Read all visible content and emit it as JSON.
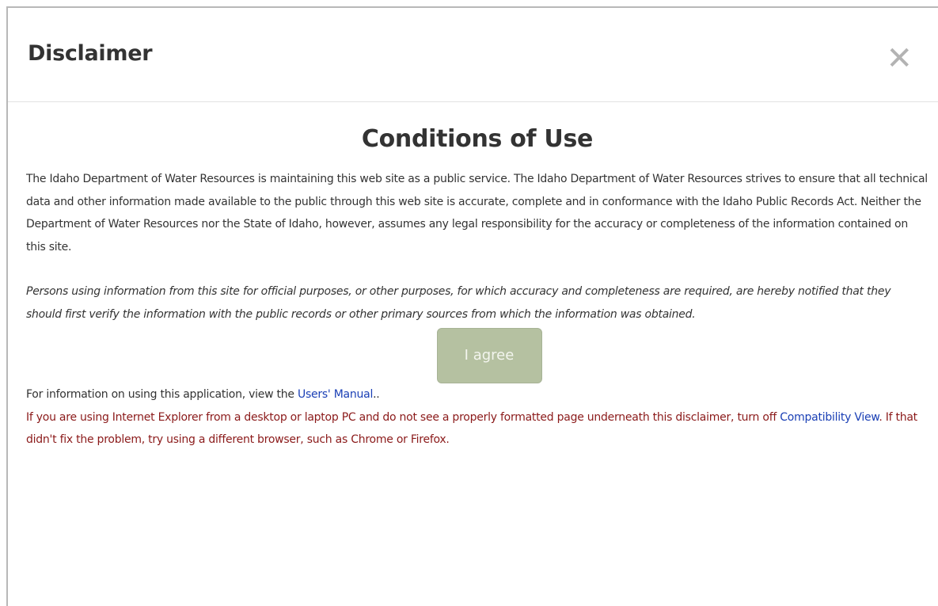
{
  "modal": {
    "title": "Disclaimer",
    "close_glyph": "✕"
  },
  "body": {
    "heading": "Conditions of Use",
    "paragraph1": "The Idaho Department of Water Resources is maintaining this web site as a public service. The Idaho Department of Water Resources strives to ensure that all technical data and other information made available to the public through this web site is accurate, complete and in conformance with the Idaho Public Records Act. Neither the Department of Water Resources nor the State of Idaho, however, assumes any legal responsibility for the accuracy or completeness of the information contained on this site.",
    "paragraph2": "Persons using information from this site for official purposes, or other purposes, for which accuracy and completeness are required, are hereby notified that they should first verify the information with the public records or other primary sources from which the information was obtained.",
    "agree_label": "I agree",
    "info_prefix": "For information on using this application, view the ",
    "manual_link": "Users' Manual",
    "info_suffix": "..",
    "warn_prefix": "If you are using Internet Explorer from a desktop or laptop PC and do not see a properly formatted page underneath this disclaimer, turn off ",
    "compat_link": "Compatibility View",
    "warn_suffix": ". If that didn't fix the problem, try using a different browser, such as Chrome or Firefox."
  },
  "colors": {
    "agree_button_bg": "#b5c1a1",
    "warning_text": "#8b1a1a",
    "link": "#1a3fb5"
  }
}
